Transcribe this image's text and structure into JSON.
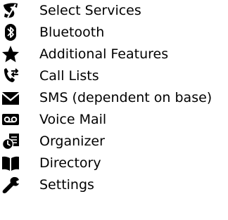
{
  "menu": {
    "items": [
      {
        "icon": "select-services-icon",
        "label": "Select Services"
      },
      {
        "icon": "bluetooth-icon",
        "label": "Bluetooth"
      },
      {
        "icon": "star-icon",
        "label": "Additional Features"
      },
      {
        "icon": "call-lists-icon",
        "label": "Call Lists"
      },
      {
        "icon": "envelope-icon",
        "label": "SMS (dependent on base)"
      },
      {
        "icon": "voicemail-icon",
        "label": "Voice Mail"
      },
      {
        "icon": "organizer-icon",
        "label": "Organizer"
      },
      {
        "icon": "directory-book-icon",
        "label": "Directory"
      },
      {
        "icon": "wrench-icon",
        "label": "Settings"
      }
    ]
  },
  "colors": {
    "text": "#000000",
    "icon": "#000000",
    "background": "#ffffff"
  }
}
